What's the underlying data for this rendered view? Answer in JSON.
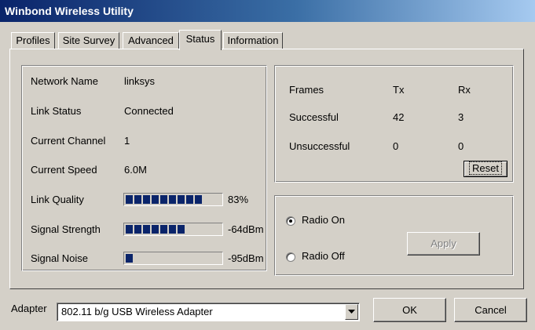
{
  "window": {
    "title": "Winbond Wireless Utility"
  },
  "tabs": [
    {
      "label": "Profiles"
    },
    {
      "label": "Site Survey"
    },
    {
      "label": "Advanced"
    },
    {
      "label": "Status",
      "active": true
    },
    {
      "label": "Information"
    }
  ],
  "status": {
    "network_name": {
      "label": "Network Name",
      "value": "linksys"
    },
    "link_status": {
      "label": "Link Status",
      "value": "Connected"
    },
    "current_channel": {
      "label": "Current Channel",
      "value": "1"
    },
    "current_speed": {
      "label": "Current Speed",
      "value": "6.0M"
    },
    "link_quality": {
      "label": "Link Quality",
      "value": "83%",
      "level_fraction": 0.83
    },
    "signal_strength": {
      "label": "Signal Strength",
      "value": "-64dBm",
      "level_fraction": 0.66
    },
    "signal_noise": {
      "label": "Signal Noise",
      "value": "-95dBm",
      "level_fraction": 0.08
    }
  },
  "frames": {
    "header": {
      "label": "Frames",
      "tx": "Tx",
      "rx": "Rx"
    },
    "successful": {
      "label": "Successful",
      "tx": "42",
      "rx": "3"
    },
    "unsuccessful": {
      "label": "Unsuccessful",
      "tx": "0",
      "rx": "0"
    },
    "reset_label": "Reset"
  },
  "radio": {
    "on_label": "Radio On",
    "off_label": "Radio Off",
    "selected": "on",
    "apply_label": "Apply"
  },
  "footer": {
    "adapter_label": "Adapter",
    "adapter_value": "802.11 b/g USB Wireless Adapter",
    "ok_label": "OK",
    "cancel_label": "Cancel"
  },
  "colors": {
    "titlebar_start": "#0a246a",
    "titlebar_end": "#a6caf0",
    "face": "#d4d0c8",
    "bar_fill": "#0a246a"
  }
}
